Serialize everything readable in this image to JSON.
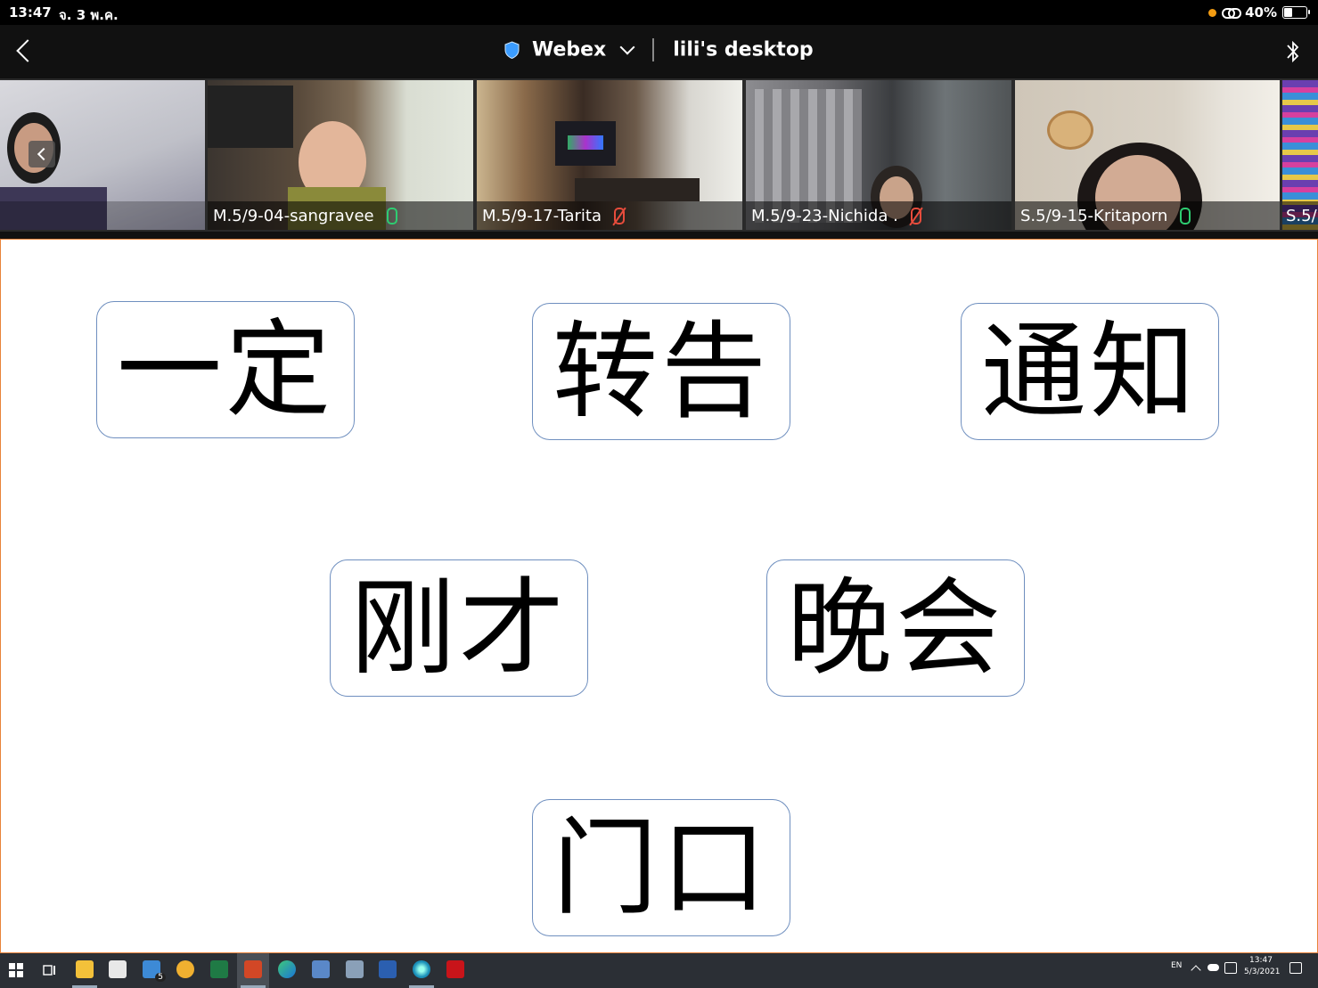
{
  "status_bar": {
    "time": "13:47",
    "date": "จ. 3 พ.ค.",
    "battery_percent": "40%",
    "battery_level": 0.4
  },
  "header": {
    "app_name": "Webex",
    "session_title": "lili's desktop"
  },
  "participants": [
    {
      "label": "",
      "mic": "none"
    },
    {
      "label": "M.5/9-04-sangravee",
      "mic": "on"
    },
    {
      "label": "M.5/9-17-Tarita",
      "mic": "muted"
    },
    {
      "label": "M.5/9-23-Nichida .",
      "mic": "muted"
    },
    {
      "label": "S.5/9-15-Kritaporn",
      "mic": "on"
    },
    {
      "label": "S.5/",
      "mic": "none"
    }
  ],
  "slide": {
    "words": [
      "一定",
      "转告",
      "通知",
      "刚才",
      "晚会",
      "门口"
    ]
  },
  "taskbar": {
    "language": "EN",
    "clock_time": "13:47",
    "clock_date": "5/3/2021",
    "mail_badge": "5"
  },
  "colors": {
    "slide_border": "#e8833a",
    "card_border": "#6f8fbf",
    "mic_on": "#2ecc71",
    "mic_muted": "#e74c3c",
    "webex_shield": "#3b9cff"
  }
}
